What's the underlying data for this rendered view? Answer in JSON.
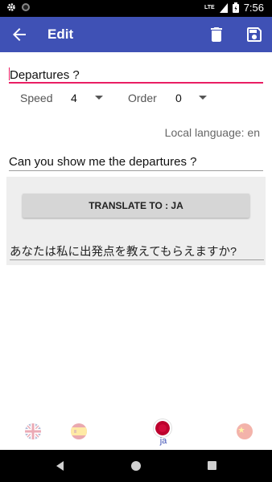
{
  "status_bar": {
    "time": "7:56",
    "network": "LTE",
    "icons": [
      "gear-icon",
      "circle-icon",
      "signal-icon",
      "battery-icon"
    ]
  },
  "app_bar": {
    "title": "Edit",
    "back_icon": "arrow-left-icon",
    "delete_icon": "trash-icon",
    "save_icon": "floppy-disk-icon",
    "color": "#3f51b5"
  },
  "form": {
    "phrase_value": "Departures ?",
    "speed_label": "Speed",
    "speed_value": "4",
    "order_label": "Order",
    "order_value": "0",
    "local_language": "Local language: en",
    "english_value": "Can you show me the departures ?"
  },
  "translate": {
    "button_label": "TRANSLATE TO : JA",
    "result": "あなたは私に出発点を教えてもらえますか?"
  },
  "bottom_nav": {
    "items": [
      {
        "flag": "uk-flag-icon",
        "label": ""
      },
      {
        "flag": "spain-flag-icon",
        "label": ""
      },
      {
        "flag": "japan-flag-icon",
        "label": "ja",
        "active": true
      },
      {
        "flag": "china-flag-icon",
        "label": ""
      }
    ],
    "accent": "#3f51b5"
  },
  "system_nav": {
    "icons": [
      "back-icon",
      "home-icon",
      "recents-icon"
    ]
  }
}
